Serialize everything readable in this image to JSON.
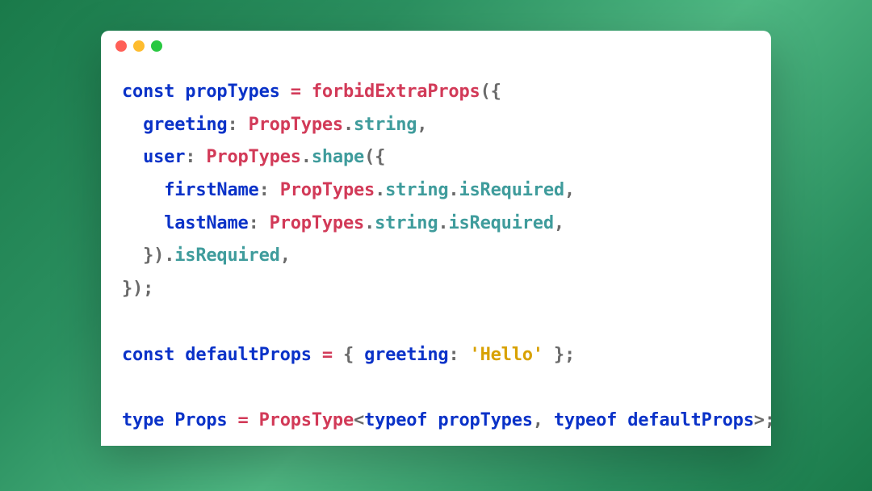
{
  "tokens": {
    "const": "const",
    "type_kw": "type",
    "typeof": "typeof",
    "propTypes": "propTypes",
    "defaultProps": "defaultProps",
    "Props": "Props",
    "PropsType": "PropsType",
    "forbidExtraProps": "forbidExtraProps",
    "PropTypes": "PropTypes",
    "greeting": "greeting",
    "user": "user",
    "firstName": "firstName",
    "lastName": "lastName",
    "string": "string",
    "shape": "shape",
    "isRequired": "isRequired",
    "eq": " = ",
    "hello": "'Hello'",
    "dot": ".",
    "colon_sp": ": ",
    "comma": ",",
    "semi": ";",
    "lp": "(",
    "rp": ")",
    "lb": "{",
    "rb": "}",
    "lbs": "{ ",
    "rbs": " }",
    "lt": "<",
    "gt": ">",
    "cs": ", ",
    "rp_lb": "({",
    "rb_rp": "})"
  },
  "indent": {
    "i1": "  ",
    "i2": "    ",
    "i3": "      "
  },
  "colors": {
    "keyword": "#0a32c8",
    "class": "#d23a58",
    "member": "#3f9c9c",
    "punct": "#6a6a6a",
    "string": "#d8a100",
    "dot_red": "#ff5f57",
    "dot_yellow": "#febc2e",
    "dot_green": "#28c840",
    "window_bg": "#ffffff"
  }
}
